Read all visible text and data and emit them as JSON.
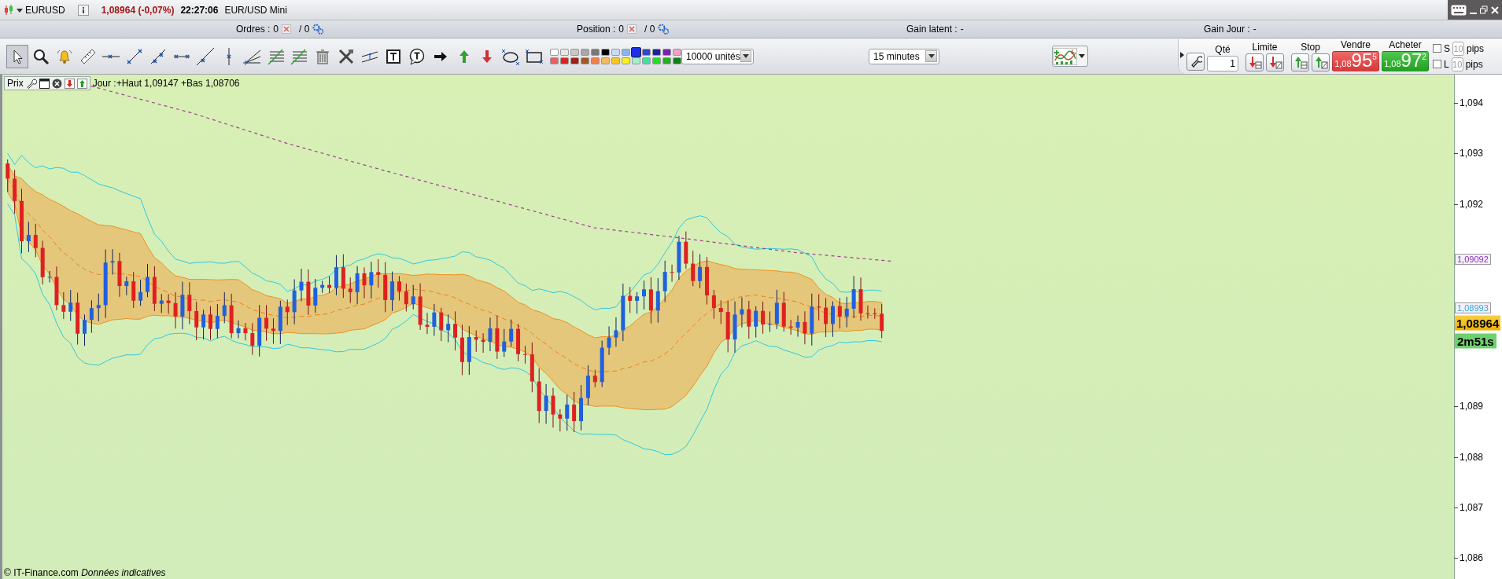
{
  "title_bar": {
    "symbol": "EURUSD",
    "last_price": "1,08964 (-0,07%)",
    "time": "22:27:06",
    "instrument": "EUR/USD Mini"
  },
  "summary_bar": [
    {
      "kind": "orders",
      "label": "Ordres :",
      "value": "0",
      "secondary": "/ 0"
    },
    {
      "kind": "orders",
      "label": "Position :",
      "value": "0",
      "secondary": "/ 0"
    },
    {
      "kind": "gain",
      "label": "Gain latent :",
      "value": "-"
    },
    {
      "kind": "gain",
      "label": "Gain Jour :",
      "value": "-"
    }
  ],
  "toolbar": {
    "tools": [
      {
        "kind": "pointer",
        "selected": true
      },
      {
        "kind": "zoom",
        "selected": false
      },
      {
        "kind": "alert",
        "selected": false
      },
      {
        "kind": "ruler",
        "selected": false
      },
      {
        "kind": "hline",
        "selected": false
      },
      {
        "kind": "segment",
        "selected": false
      },
      {
        "kind": "ray",
        "selected": false
      },
      {
        "kind": "hsegment",
        "selected": false
      },
      {
        "kind": "trend",
        "selected": false
      },
      {
        "kind": "vline",
        "selected": false
      },
      {
        "kind": "fan",
        "selected": false
      },
      {
        "kind": "fibo",
        "selected": false
      },
      {
        "kind": "fibo",
        "selected": false
      },
      {
        "kind": "trash",
        "selected": false
      },
      {
        "kind": "tools",
        "selected": false
      },
      {
        "kind": "channel",
        "selected": false
      },
      {
        "kind": "text",
        "selected": false
      },
      {
        "kind": "callout",
        "selected": false
      },
      {
        "kind": "arrow-right",
        "selected": false
      },
      {
        "kind": "arrow-up",
        "selected": false
      },
      {
        "kind": "arrow-down",
        "selected": false
      },
      {
        "kind": "ellipse",
        "selected": false
      },
      {
        "kind": "rectangle",
        "selected": false
      }
    ],
    "palette": [
      {
        "color": "#ffffff",
        "selected": false
      },
      {
        "color": "#e6e6e6",
        "selected": false
      },
      {
        "color": "#c8c8c8",
        "selected": false
      },
      {
        "color": "#a8a8a8",
        "selected": false
      },
      {
        "color": "#787878",
        "selected": false
      },
      {
        "color": "#000000",
        "selected": false
      },
      {
        "color": "#c8dcf8",
        "selected": false
      },
      {
        "color": "#88b4f0",
        "selected": false
      },
      {
        "color": "#1c2ee8",
        "selected": true
      },
      {
        "color": "#3048c8",
        "selected": false
      },
      {
        "color": "#2020a0",
        "selected": false
      },
      {
        "color": "#8020b0",
        "selected": false
      },
      {
        "color": "#f0a0c8",
        "selected": false
      },
      {
        "color": "#e86060",
        "selected": false
      },
      {
        "color": "#e02020",
        "selected": false
      },
      {
        "color": "#a02010",
        "selected": false
      },
      {
        "color": "#a05a20",
        "selected": false
      },
      {
        "color": "#f08048",
        "selected": false
      },
      {
        "color": "#f8b860",
        "selected": false
      },
      {
        "color": "#f8c820",
        "selected": false
      },
      {
        "color": "#f8f020",
        "selected": false
      },
      {
        "color": "#a0f0c8",
        "selected": false
      },
      {
        "color": "#40e0a0",
        "selected": false
      },
      {
        "color": "#20e020",
        "selected": false
      },
      {
        "color": "#20b020",
        "selected": false
      },
      {
        "color": "#108010",
        "selected": false
      }
    ],
    "quantity_select": "10000 unités",
    "period_select": "15 minutes"
  },
  "order_panel": {
    "qty_label": "Qté",
    "qty": "1",
    "limit_label": "Limite",
    "stop_label": "Stop",
    "sell": {
      "label": "Vendre",
      "prefix": "1,08",
      "main": "95",
      "suffix": "5"
    },
    "buy": {
      "label": "Acheter",
      "prefix": "1,08",
      "main": "97",
      "suffix": "2"
    },
    "options": [
      {
        "label": "S",
        "checked": false,
        "value": "10",
        "disabled": true,
        "unit": "pips"
      },
      {
        "label": "L",
        "checked": false,
        "value": "10",
        "disabled": true,
        "unit": "pips"
      }
    ]
  },
  "chart": {
    "panel_label": "Prix",
    "day_range": "Jour :+Haut 1,09147 +Bas 1,08706",
    "y_ticks": [
      "1,094",
      "1,093",
      "1,092",
      "1,089",
      "1,088",
      "1,087",
      "1,086"
    ],
    "price_labels": [
      {
        "text": "1,09092",
        "color": "#9030c0"
      },
      {
        "text": "1,08993",
        "color": "#30a8e0"
      }
    ],
    "last_price": "1,08964",
    "countdown": "2m51s",
    "footer": "© IT-Finance.com *Données indicatives*"
  }
}
